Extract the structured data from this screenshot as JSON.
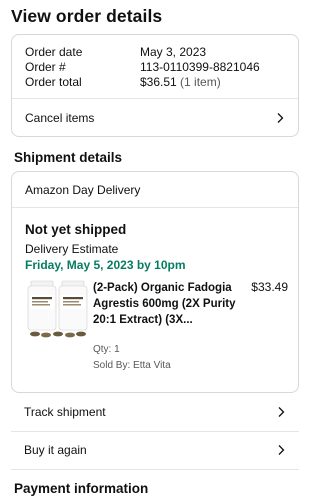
{
  "page": {
    "title": "View order details"
  },
  "summary": {
    "order_date_label": "Order date",
    "order_date_value": "May 3, 2023",
    "order_number_label": "Order #",
    "order_number_value": "113-0110399-8821046",
    "order_total_label": "Order total",
    "order_total_value": "$36.51",
    "order_total_items": "(1 item)",
    "cancel_label": "Cancel items"
  },
  "shipment": {
    "section_title": "Shipment details",
    "delivery_type": "Amazon Day Delivery",
    "status": "Not yet shipped",
    "estimate_label": "Delivery Estimate",
    "estimate_date": "Friday, May 5, 2023 by 10pm",
    "product": {
      "title": "(2-Pack) Organic Fadogia Agrestis 600mg (2X Purity 20:1 Extract) (3X...",
      "price": "$33.49",
      "qty": "Qty: 1",
      "sold_by": "Sold By: Etta Vita",
      "image_icon": "supplement-bottles-image"
    }
  },
  "actions": {
    "track": "Track shipment",
    "buy_again": "Buy it again"
  },
  "payment": {
    "section_title": "Payment information"
  },
  "colors": {
    "accent_green": "#067d62",
    "border": "#d5d9d9",
    "muted": "#565959"
  },
  "icons": {
    "chevron": "chevron-right-icon"
  }
}
